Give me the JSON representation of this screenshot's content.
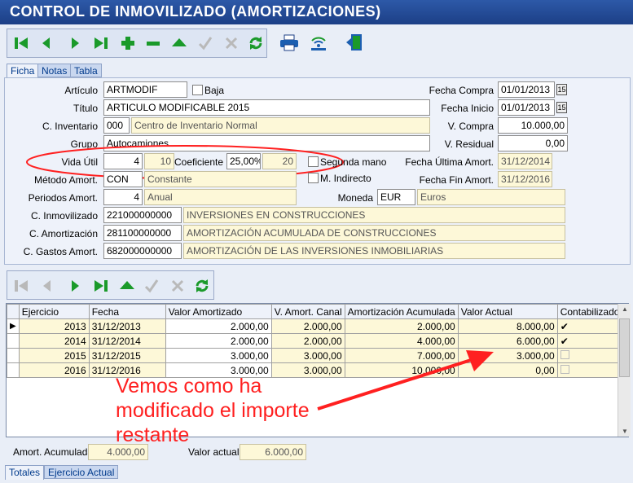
{
  "window": {
    "title": "CONTROL DE INMOVILIZADO (AMORTIZACIONES)"
  },
  "tabs": [
    "Ficha",
    "Notas",
    "Tabla"
  ],
  "form": {
    "articulo_label": "Artículo",
    "articulo": "ARTMODIF",
    "baja_label": "Baja",
    "titulo_label": "Título",
    "titulo": "ARTICULO MODIFICABLE 2015",
    "cinv_label": "C. Inventario",
    "cinv_code": "000",
    "cinv_name": "Centro de Inventario Normal",
    "grupo_label": "Grupo",
    "grupo": "Autocamiones",
    "vida_label": "Vida Útil",
    "vida": "4",
    "vida2": "10",
    "coef_label": "Coeficiente",
    "coef": "25,00%",
    "coef2": "20",
    "segunda_label": "Segunda mano",
    "mind_label": "M. Indirecto",
    "metodo_label": "Método Amort.",
    "metodo_code": "CON",
    "metodo_name": "Constante",
    "periodos_label": "Periodos Amort.",
    "periodos": "4",
    "periodos_name": "Anual",
    "moneda_label": "Moneda",
    "moneda_code": "EUR",
    "moneda_name": "Euros",
    "cinm_label": "C. Inmovilizado",
    "cinm_code": "221000000000",
    "cinm_name": "INVERSIONES EN CONSTRUCCIONES",
    "camort_label": "C. Amortización",
    "camort_code": "281100000000",
    "camort_name": "AMORTIZACIÓN ACUMULADA DE CONSTRUCCIONES",
    "cgastos_label": "C. Gastos Amort.",
    "cgastos_code": "682000000000",
    "cgastos_name": "AMORTIZACIÓN DE LAS INVERSIONES INMOBILIARIAS",
    "fcompra_label": "Fecha Compra",
    "fcompra": "01/01/2013",
    "finicio_label": "Fecha Inicio",
    "finicio": "01/01/2013",
    "vcompra_label": "V. Compra",
    "vcompra": "10.000,00",
    "vresidual_label": "V. Residual",
    "vresidual": "0,00",
    "fultima_label": "Fecha Última Amort.",
    "fultima": "31/12/2014",
    "ffin_label": "Fecha Fin Amort.",
    "ffin": "31/12/2016",
    "cal_label": "15"
  },
  "grid": {
    "headers": [
      "Ejercicio",
      "Fecha",
      "Valor Amortizado",
      "V. Amort. Canal",
      "Amortización Acumulada",
      "Valor Actual",
      "Contabilizado"
    ],
    "rows": [
      {
        "ej": "2013",
        "fecha": "31/12/2013",
        "va": "2.000,00",
        "vac": "2.000,00",
        "aa": "2.000,00",
        "vact": "8.000,00",
        "cont": true
      },
      {
        "ej": "2014",
        "fecha": "31/12/2014",
        "va": "2.000,00",
        "vac": "2.000,00",
        "aa": "4.000,00",
        "vact": "6.000,00",
        "cont": true
      },
      {
        "ej": "2015",
        "fecha": "31/12/2015",
        "va": "3.000,00",
        "vac": "3.000,00",
        "aa": "7.000,00",
        "vact": "3.000,00",
        "cont": false
      },
      {
        "ej": "2016",
        "fecha": "31/12/2016",
        "va": "3.000,00",
        "vac": "3.000,00",
        "aa": "10.000,00",
        "vact": "0,00",
        "cont": false
      }
    ]
  },
  "footer": {
    "amort_label": "Amort. Acumulada",
    "amort": "4.000,00",
    "valor_label": "Valor actual",
    "valor": "6.000,00"
  },
  "bottom_tabs": [
    "Totales",
    "Ejercicio Actual"
  ],
  "annotation": {
    "line1": "Vemos como ha",
    "line2": "modificado el importe",
    "line3": "restante"
  },
  "colors": {
    "nav": "#1a9a2a",
    "title": "#1c3f86",
    "annotation": "#ff2020"
  }
}
